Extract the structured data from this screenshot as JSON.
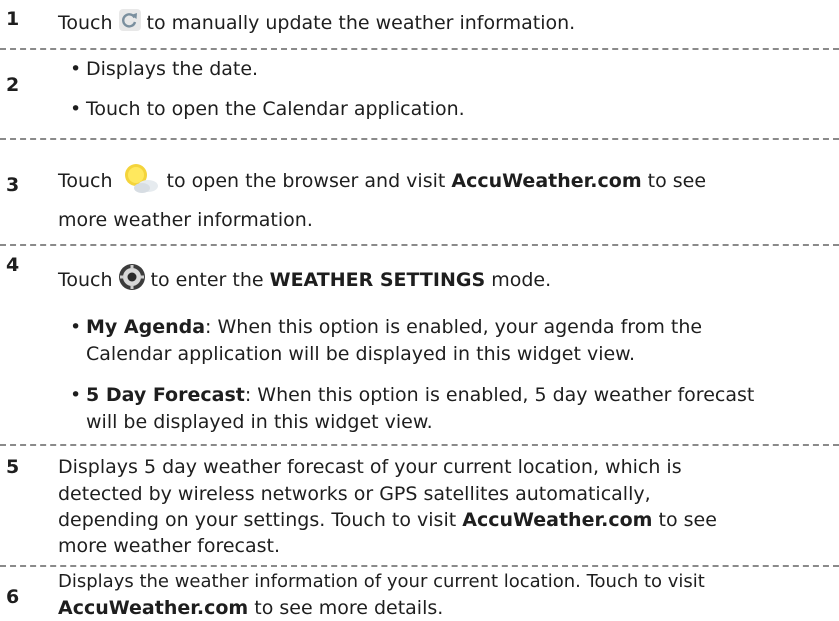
{
  "items": [
    {
      "number": "1",
      "pre": "Touch",
      "post": "to manually update the weather information."
    },
    {
      "number": "2",
      "bullets": [
        "Displays the date.",
        "Touch to open the Calendar application."
      ]
    },
    {
      "number": "3",
      "pre": "Touch",
      "post": "to open the browser and visit",
      "bold": "AccuWeather.com",
      "post2": "to see",
      "line2": "more weather information."
    },
    {
      "number": "4",
      "pre": "Touch",
      "post": "to enter the",
      "bold": "WEATHER SETTINGS",
      "post2": "mode.",
      "bullets": [
        {
          "bold": "My Agenda",
          "line1": ": When this option is enabled, your agenda from the",
          "line2": "Calendar application will be displayed in this widget view."
        },
        {
          "bold": "5 Day Forecast",
          "line1": ": When this option is enabled, 5 day weather forecast",
          "line2": "will be displayed in this widget view."
        }
      ]
    },
    {
      "number": "5",
      "lines": [
        "Displays 5 day weather forecast of your current location, which is",
        "detected by wireless networks or GPS satellites automatically,",
        "depending on your settings. Touch to visit"
      ],
      "bold": "AccuWeather.com",
      "post": "to see",
      "line4": "more weather forecast."
    },
    {
      "number": "6",
      "line1": "Displays the weather information of your current location. Touch to visit",
      "bold": "AccuWeather.com",
      "post": "to see more details."
    }
  ],
  "icons": {
    "refresh": "refresh-icon",
    "weather": "sun-cloud-icon",
    "settings": "settings-icon"
  }
}
